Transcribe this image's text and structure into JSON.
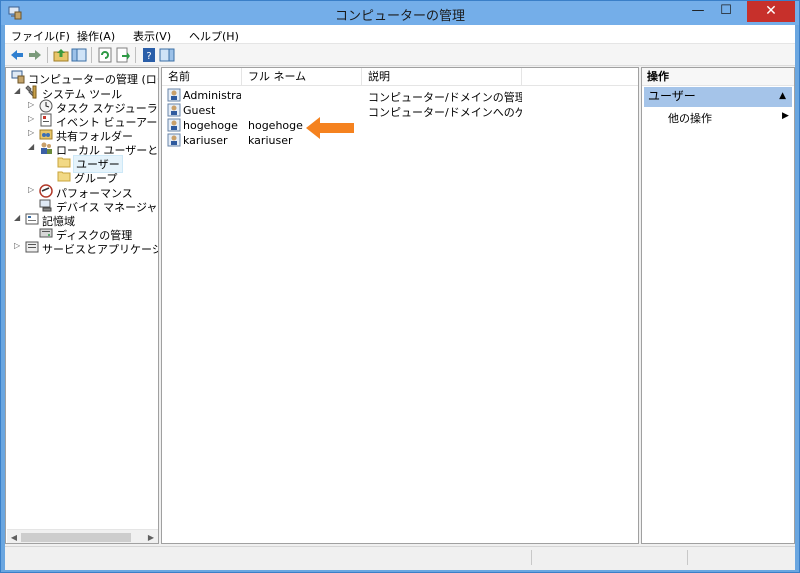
{
  "window": {
    "title": "コンピューターの管理",
    "minimize_glyph": "—",
    "maximize_glyph": "☐",
    "close_glyph": "✕"
  },
  "menu": {
    "items": [
      "ファイル(F)",
      "操作(A)",
      "表示(V)",
      "ヘルプ(H)"
    ]
  },
  "toolbar": {
    "icons": [
      "back-arrow-icon",
      "forward-arrow-icon",
      "up-folder-icon",
      "show-hide-tree-icon",
      "refresh-icon",
      "export-list-icon",
      "help-icon",
      "show-hide-action-pane-icon"
    ]
  },
  "tree": {
    "items": [
      {
        "label": "コンピューターの管理 (ローカル)",
        "expander": "",
        "icon": "computer-management-icon"
      },
      {
        "label": "システム ツール",
        "expander": "◢",
        "icon": "system-tools-icon"
      },
      {
        "label": "タスク スケジューラ",
        "expander": "▷",
        "icon": "clock-icon"
      },
      {
        "label": "イベント ビューアー",
        "expander": "▷",
        "icon": "event-viewer-icon"
      },
      {
        "label": "共有フォルダー",
        "expander": "▷",
        "icon": "shared-folder-icon"
      },
      {
        "label": "ローカル ユーザーとグループ",
        "expander": "◢",
        "icon": "local-users-groups-icon"
      },
      {
        "label": "ユーザー",
        "expander": "",
        "icon": "folder-icon"
      },
      {
        "label": "グループ",
        "expander": "",
        "icon": "folder-icon"
      },
      {
        "label": "パフォーマンス",
        "expander": "▷",
        "icon": "performance-icon"
      },
      {
        "label": "デバイス マネージャー",
        "expander": "",
        "icon": "device-manager-icon"
      },
      {
        "label": "記憶域",
        "expander": "◢",
        "icon": "storage-icon"
      },
      {
        "label": "ディスクの管理",
        "expander": "",
        "icon": "disk-management-icon"
      },
      {
        "label": "サービスとアプリケーション",
        "expander": "▷",
        "icon": "services-icon"
      }
    ]
  },
  "list": {
    "columns": [
      "名前",
      "フル ネーム",
      "説明"
    ],
    "rows": [
      {
        "name": "Administra...",
        "full_name": "",
        "description": "コンピューター/ドメインの管理用 (ビル..."
      },
      {
        "name": "Guest",
        "full_name": "",
        "description": "コンピューター/ドメインへのゲスト アク..."
      },
      {
        "name": "hogehoge",
        "full_name": "hogehoge",
        "description": ""
      },
      {
        "name": "kariuser",
        "full_name": "kariuser",
        "description": ""
      }
    ]
  },
  "actions": {
    "header": "操作",
    "section": "ユーザー",
    "section_toggle": "▲",
    "item": "他の操作",
    "item_arrow": "▶"
  },
  "scrollbar": {
    "left_arrow": "◀",
    "right_arrow": "▶"
  },
  "colors": {
    "title_bar": "#74aee9",
    "close_button": "#c7302b",
    "action_section": "#a5c4e9",
    "annotation_arrow": "#f5821f"
  }
}
